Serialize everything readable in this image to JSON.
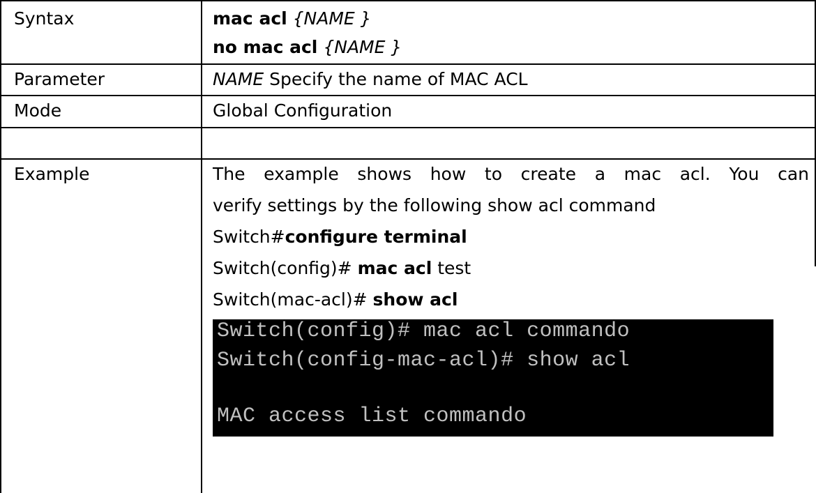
{
  "rows": {
    "syntax": {
      "label": "Syntax",
      "line1_cmd": "mac acl",
      "line1_arg": "{NAME }",
      "line2_cmd": "no mac acl",
      "line2_arg": "{NAME }"
    },
    "parameter": {
      "label": "Parameter",
      "name": "NAME",
      "desc": "Specify the name of MAC ACL"
    },
    "mode": {
      "label": "Mode",
      "value": "Global Configuration"
    },
    "example": {
      "label": "Example",
      "desc_line1": "The example shows how to create a mac acl. You can",
      "desc_line2": "verify settings by the following show acl command",
      "cmd1_prefix": "Switch#",
      "cmd1_bold": "configure terminal",
      "cmd2_prefix": "Switch(config)# ",
      "cmd2_bold": "mac acl",
      "cmd2_suffix": " test",
      "cmd3_prefix": "Switch(mac-acl)# ",
      "cmd3_bold": "show acl"
    }
  },
  "terminal": {
    "line1": "Switch(config)# mac acl commando",
    "line2": "Switch(config-mac-acl)# show acl",
    "line3": "",
    "line4": "MAC access list commando"
  }
}
